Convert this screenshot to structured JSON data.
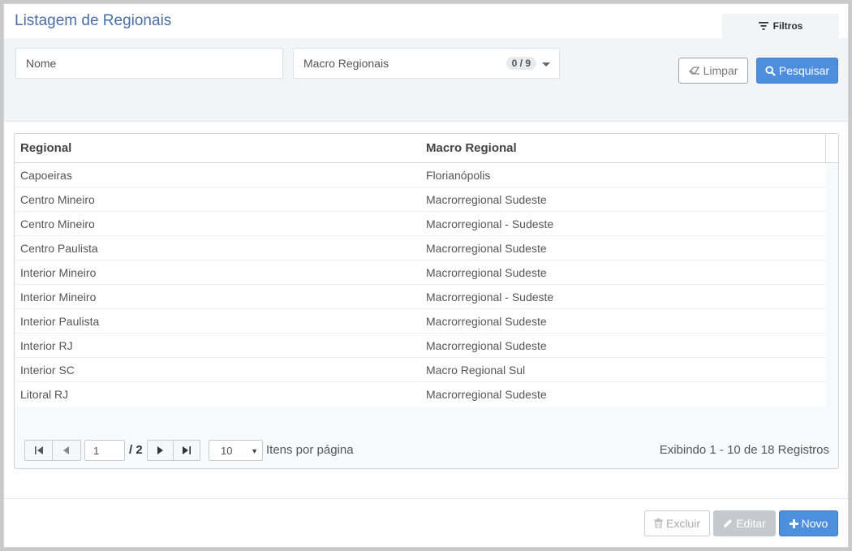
{
  "page": {
    "title": "Listagem de Regionais"
  },
  "filters": {
    "tab_label": "Filtros",
    "nome_placeholder": "Nome",
    "macro_label": "Macro Regionais",
    "macro_badge": "0 / 9",
    "limpar_label": "Limpar",
    "pesquisar_label": "Pesquisar"
  },
  "table": {
    "columns": [
      "Regional",
      "Macro Regional"
    ],
    "rows": [
      [
        "Capoeiras",
        "Florianópolis"
      ],
      [
        "Centro Mineiro",
        "Macrorregional Sudeste"
      ],
      [
        "Centro Mineiro",
        "Macrorregional - Sudeste"
      ],
      [
        "Centro Paulista",
        "Macrorregional Sudeste"
      ],
      [
        "Interior Mineiro",
        "Macrorregional Sudeste"
      ],
      [
        "Interior Mineiro",
        "Macrorregional - Sudeste"
      ],
      [
        "Interior Paulista",
        "Macrorregional Sudeste"
      ],
      [
        "Interior RJ",
        "Macrorregional Sudeste"
      ],
      [
        "Interior SC",
        "Macro Regional Sul"
      ],
      [
        "Litoral RJ",
        "Macrorregional Sudeste"
      ]
    ]
  },
  "pager": {
    "current_page": "1",
    "total_pages": "/ 2",
    "page_size": "10",
    "page_size_label": "Itens por página",
    "info": "Exibindo 1 - 10 de 18 Registros"
  },
  "actions": {
    "excluir_label": "Excluir",
    "editar_label": "Editar",
    "novo_label": "Novo"
  },
  "colors": {
    "title": "#4a6fa8",
    "primary": "#4e8fdd",
    "panel_bg": "#f3f4f6",
    "disabled": "#c5c8cc"
  }
}
